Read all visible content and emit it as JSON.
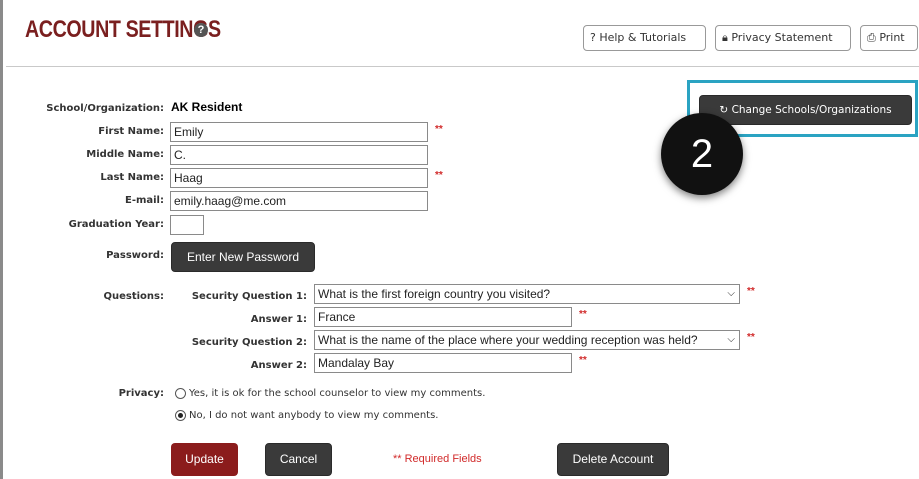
{
  "header": {
    "title": "ACCOUNT SETTINGS",
    "help_icon": "?",
    "buttons": {
      "help": "? Help & Tutorials",
      "privacy": "Privacy Statement",
      "print": "Print"
    }
  },
  "change_button": "Change Schools/Organizations",
  "callout_number": "2",
  "form": {
    "school_label": "School/Organization:",
    "school_value": "AK Resident",
    "first_name_label": "First Name:",
    "first_name_value": "Emily",
    "middle_name_label": "Middle Name:",
    "middle_name_value": "C.",
    "last_name_label": "Last Name:",
    "last_name_value": "Haag",
    "email_label": "E-mail:",
    "email_value": "emily.haag@me.com",
    "grad_year_label": "Graduation Year:",
    "grad_year_value": "",
    "password_label": "Password:",
    "password_button": "Enter New Password",
    "questions_label": "Questions:",
    "sq1_label": "Security Question 1:",
    "sq1_value": "What is the first foreign country you visited?",
    "a1_label": "Answer 1:",
    "a1_value": "France",
    "sq2_label": "Security Question 2:",
    "sq2_value": "What is the name of the place where your wedding reception was held?",
    "a2_label": "Answer 2:",
    "a2_value": "Mandalay Bay",
    "required_marker": "**",
    "privacy_label": "Privacy:",
    "privacy_yes": "Yes, it is ok for the school counselor to view my comments.",
    "privacy_no": "No, I do not want anybody to view my comments."
  },
  "actions": {
    "update": "Update",
    "cancel": "Cancel",
    "required_note": "** Required Fields",
    "delete": "Delete Account"
  },
  "colors": {
    "title": "#7a1f1f",
    "update_button": "#8b1c1c",
    "highlight": "#2aa3c2",
    "required": "#d12a2a"
  }
}
